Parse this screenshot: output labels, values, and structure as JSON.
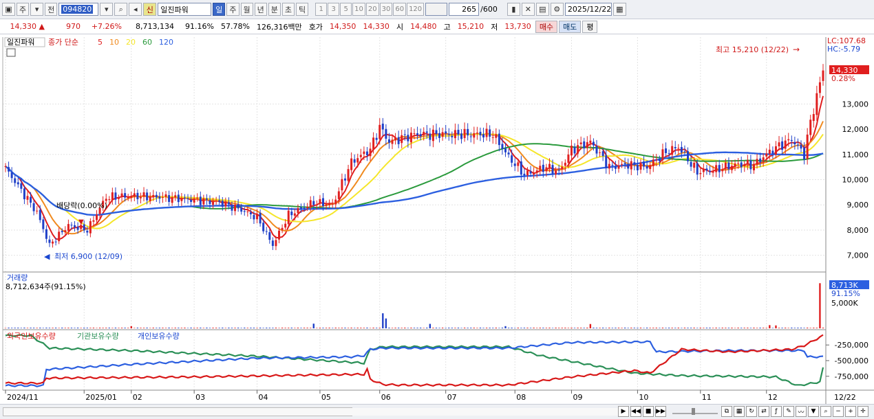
{
  "toolbar": {
    "period_type": "주",
    "prev_label": "전",
    "code": "094820",
    "new_badge": "신",
    "stock_name": "일진파워",
    "periods": [
      "일",
      "주",
      "월",
      "년",
      "분",
      "초",
      "틱"
    ],
    "active_period": "일",
    "intervals": [
      "1",
      "3",
      "5",
      "10",
      "20",
      "30",
      "60",
      "120"
    ],
    "count": "265",
    "count_max": "/600",
    "date": "2025/12/22"
  },
  "quote": {
    "price": "14,330",
    "change": "970",
    "change_pct": "+7.26%",
    "volume": "8,713,134",
    "volume_ratio": "91.16%",
    "turnover": "57.78%",
    "amount": "126,316백만",
    "bid_label": "호가",
    "bid": "14,350",
    "ask": "14,330",
    "open_label": "시",
    "open": "14,480",
    "high_label": "고",
    "high": "15,210",
    "low_label": "저",
    "low": "13,730",
    "buy_label": "매수",
    "sell_label": "매도",
    "eval_label": "평"
  },
  "chart_data": {
    "type": "line",
    "legend_main": {
      "name": "일진파워",
      "price_label": "종가 단순",
      "ma": [
        "5",
        "10",
        "20",
        "60",
        "120"
      ]
    },
    "colors": {
      "ma5": "#e01e1e",
      "ma10": "#f08a1e",
      "ma20": "#f5e62a",
      "ma60": "#2a9a3c",
      "ma120": "#2c5fe0",
      "up": "#e02020",
      "down": "#2040c8"
    },
    "lc": "LC:107.68",
    "hc": "HC:-5.79",
    "last_price_tag": "14,330",
    "last_pct_tag": "0.28%",
    "high_annotation": "최고 15,210 (12/22)",
    "low_annotation": "최저 6,900 (12/09)",
    "dividend_label": "배당락(0.00%)",
    "price_ticks": [
      "13,000",
      "12,000",
      "11,000",
      "10,000",
      "9,000",
      "8,000",
      "7,000"
    ],
    "y_range": [
      6500,
      15600
    ],
    "months": [
      "2024/11",
      "2025/01",
      "02",
      "03",
      "04",
      "05",
      "06",
      "07",
      "08",
      "09",
      "10",
      "11",
      "12"
    ],
    "month_x_index": [
      0,
      25,
      40,
      60,
      80,
      100,
      119,
      140,
      162,
      180,
      201,
      221,
      242
    ],
    "axis_end_label": "12/22",
    "close_anchors": [
      [
        0,
        10450
      ],
      [
        10,
        8700
      ],
      [
        14,
        7400
      ],
      [
        20,
        8200
      ],
      [
        26,
        8000
      ],
      [
        32,
        9300
      ],
      [
        40,
        9350
      ],
      [
        50,
        9300
      ],
      [
        60,
        9200
      ],
      [
        68,
        9100
      ],
      [
        74,
        8850
      ],
      [
        80,
        8500
      ],
      [
        85,
        7400
      ],
      [
        90,
        8600
      ],
      [
        98,
        9100
      ],
      [
        104,
        9000
      ],
      [
        110,
        10700
      ],
      [
        116,
        11200
      ],
      [
        119,
        12100
      ],
      [
        122,
        11500
      ],
      [
        130,
        11800
      ],
      [
        145,
        11800
      ],
      [
        155,
        11800
      ],
      [
        160,
        10900
      ],
      [
        165,
        10200
      ],
      [
        172,
        10500
      ],
      [
        176,
        10300
      ],
      [
        180,
        11200
      ],
      [
        186,
        11500
      ],
      [
        192,
        10500
      ],
      [
        198,
        10600
      ],
      [
        204,
        10500
      ],
      [
        210,
        11100
      ],
      [
        214,
        11300
      ],
      [
        220,
        10300
      ],
      [
        226,
        10400
      ],
      [
        232,
        10600
      ],
      [
        238,
        10600
      ],
      [
        244,
        11200
      ],
      [
        250,
        11600
      ],
      [
        254,
        11000
      ],
      [
        256,
        12300
      ],
      [
        260,
        14330
      ]
    ],
    "volume_panel": {
      "title": "거래량",
      "summary": "8,712,634주(91.15%)",
      "last_tag": "8,713K",
      "pct_tag": "91.15%",
      "tick": "5,000K",
      "spikes": [
        [
          40,
          420
        ],
        [
          98,
          900
        ],
        [
          120,
          2900
        ],
        [
          121,
          1900
        ],
        [
          135,
          860
        ],
        [
          159,
          420
        ],
        [
          186,
          830
        ],
        [
          243,
          620
        ],
        [
          245,
          560
        ],
        [
          259,
          8700
        ]
      ]
    },
    "holdings_panel": {
      "series": [
        {
          "name": "외국인보유수량",
          "color": "#d81818"
        },
        {
          "name": "기관보유수량",
          "color": "#2a8f56"
        },
        {
          "name": "개인보유수량",
          "color": "#2c5fe0"
        }
      ],
      "ticks": [
        "-250,000",
        "-500,000",
        "-750,000"
      ],
      "y_range": [
        -950000,
        -50000
      ],
      "foreign": [
        [
          0,
          -860000
        ],
        [
          12,
          -860000
        ],
        [
          13,
          -780000
        ],
        [
          60,
          -760000
        ],
        [
          110,
          -720000
        ],
        [
          114,
          -720000
        ],
        [
          115,
          -640000
        ],
        [
          116,
          -800000
        ],
        [
          120,
          -880000
        ],
        [
          125,
          -890000
        ],
        [
          160,
          -890000
        ],
        [
          180,
          -760000
        ],
        [
          200,
          -660000
        ],
        [
          205,
          -700000
        ],
        [
          215,
          -320000
        ],
        [
          230,
          -360000
        ],
        [
          250,
          -320000
        ],
        [
          254,
          -260000
        ],
        [
          260,
          -100000
        ]
      ],
      "institution": [
        [
          0,
          -100000
        ],
        [
          8,
          -100000
        ],
        [
          14,
          -300000
        ],
        [
          40,
          -340000
        ],
        [
          80,
          -430000
        ],
        [
          114,
          -540000
        ],
        [
          116,
          -320000
        ],
        [
          120,
          -280000
        ],
        [
          160,
          -280000
        ],
        [
          170,
          -420000
        ],
        [
          200,
          -700000
        ],
        [
          215,
          -740000
        ],
        [
          245,
          -760000
        ],
        [
          252,
          -900000
        ],
        [
          259,
          -840000
        ],
        [
          260,
          -620000
        ]
      ],
      "individual": [
        [
          0,
          -900000
        ],
        [
          12,
          -900000
        ],
        [
          13,
          -640000
        ],
        [
          40,
          -560000
        ],
        [
          80,
          -460000
        ],
        [
          110,
          -440000
        ],
        [
          114,
          -420000
        ],
        [
          116,
          -320000
        ],
        [
          120,
          -300000
        ],
        [
          160,
          -300000
        ],
        [
          180,
          -210000
        ],
        [
          205,
          -200000
        ],
        [
          207,
          -360000
        ],
        [
          230,
          -340000
        ],
        [
          254,
          -340000
        ],
        [
          255,
          -440000
        ],
        [
          260,
          -440000
        ]
      ]
    }
  }
}
